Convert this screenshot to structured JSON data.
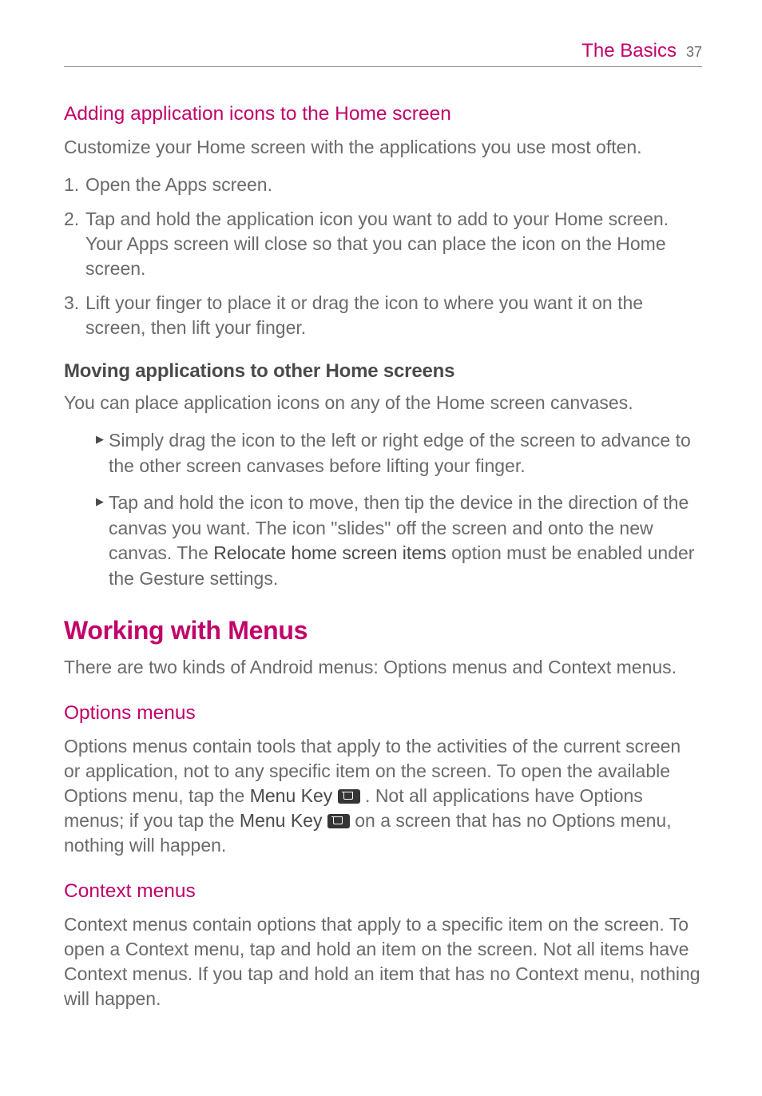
{
  "header": {
    "title": "The Basics",
    "page": "37"
  },
  "sec1": {
    "h3": "Adding application icons to the Home screen",
    "intro": "Customize your Home screen with the applications you use most often.",
    "steps": {
      "n1": "1.",
      "t1": "Open the Apps screen.",
      "n2": "2.",
      "t2": "Tap and hold the application icon you want to add to your Home screen. Your Apps screen will close so that you can place the icon on the Home screen.",
      "n3": "3.",
      "t3": "Lift your finger to place it or drag the icon to where you want it on the screen, then lift your finger."
    }
  },
  "sec2": {
    "h4": "Moving applications to other Home screens",
    "intro": "You can place application icons on any of the Home screen canvases.",
    "b1": "Simply drag the icon to the left or right edge of the screen to advance to the other screen canvases before lifting your finger.",
    "b2_a": "Tap and hold the icon to move, then tip the device in the direction of the canvas you want. The icon \"slides\" off the screen and onto the new canvas. The ",
    "b2_strong": "Relocate home screen items",
    "b2_b": " option must be enabled under the Gesture settings."
  },
  "sec3": {
    "h2": "Working with Menus",
    "intro": "There are two kinds of Android menus: Options menus and Context menus."
  },
  "sec4": {
    "h3": "Options menus",
    "p_a": "Options menus contain tools that apply to the activities of the current screen or application, not to any specific item on the screen. To open the available Options menu, tap the ",
    "p_s1": "Menu Key",
    "p_b": " . Not all applications have Options menus; if you tap the ",
    "p_s2": "Menu Key",
    "p_c": "  on a screen that has no Options menu, nothing will happen."
  },
  "sec5": {
    "h3": "Context menus",
    "p": "Context menus contain options that apply to a specific item on the screen. To open a Context menu, tap and hold an item on the screen. Not all items have Context menus. If you tap and hold an item that has no Context menu, nothing will happen."
  }
}
